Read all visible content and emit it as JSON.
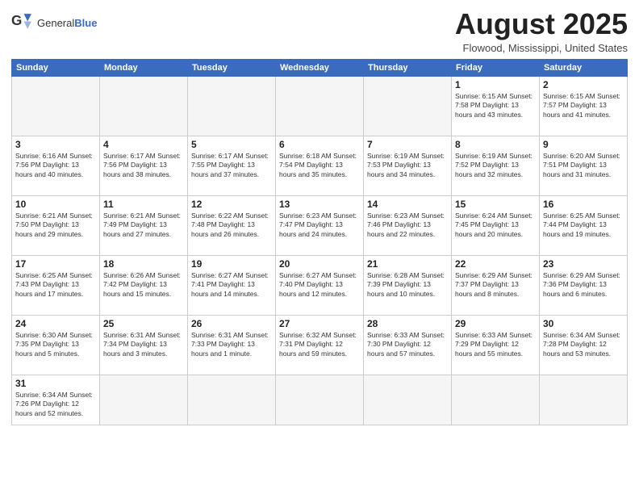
{
  "header": {
    "logo_text_normal": "General",
    "logo_text_bold": "Blue",
    "main_title": "August 2025",
    "subtitle": "Flowood, Mississippi, United States"
  },
  "calendar": {
    "days_of_week": [
      "Sunday",
      "Monday",
      "Tuesday",
      "Wednesday",
      "Thursday",
      "Friday",
      "Saturday"
    ],
    "weeks": [
      [
        {
          "day": "",
          "empty": true
        },
        {
          "day": "",
          "empty": true
        },
        {
          "day": "",
          "empty": true
        },
        {
          "day": "",
          "empty": true
        },
        {
          "day": "",
          "empty": true
        },
        {
          "day": "1",
          "info": "Sunrise: 6:15 AM\nSunset: 7:58 PM\nDaylight: 13 hours\nand 43 minutes."
        },
        {
          "day": "2",
          "info": "Sunrise: 6:15 AM\nSunset: 7:57 PM\nDaylight: 13 hours\nand 41 minutes."
        }
      ],
      [
        {
          "day": "3",
          "info": "Sunrise: 6:16 AM\nSunset: 7:56 PM\nDaylight: 13 hours\nand 40 minutes."
        },
        {
          "day": "4",
          "info": "Sunrise: 6:17 AM\nSunset: 7:56 PM\nDaylight: 13 hours\nand 38 minutes."
        },
        {
          "day": "5",
          "info": "Sunrise: 6:17 AM\nSunset: 7:55 PM\nDaylight: 13 hours\nand 37 minutes."
        },
        {
          "day": "6",
          "info": "Sunrise: 6:18 AM\nSunset: 7:54 PM\nDaylight: 13 hours\nand 35 minutes."
        },
        {
          "day": "7",
          "info": "Sunrise: 6:19 AM\nSunset: 7:53 PM\nDaylight: 13 hours\nand 34 minutes."
        },
        {
          "day": "8",
          "info": "Sunrise: 6:19 AM\nSunset: 7:52 PM\nDaylight: 13 hours\nand 32 minutes."
        },
        {
          "day": "9",
          "info": "Sunrise: 6:20 AM\nSunset: 7:51 PM\nDaylight: 13 hours\nand 31 minutes."
        }
      ],
      [
        {
          "day": "10",
          "info": "Sunrise: 6:21 AM\nSunset: 7:50 PM\nDaylight: 13 hours\nand 29 minutes."
        },
        {
          "day": "11",
          "info": "Sunrise: 6:21 AM\nSunset: 7:49 PM\nDaylight: 13 hours\nand 27 minutes."
        },
        {
          "day": "12",
          "info": "Sunrise: 6:22 AM\nSunset: 7:48 PM\nDaylight: 13 hours\nand 26 minutes."
        },
        {
          "day": "13",
          "info": "Sunrise: 6:23 AM\nSunset: 7:47 PM\nDaylight: 13 hours\nand 24 minutes."
        },
        {
          "day": "14",
          "info": "Sunrise: 6:23 AM\nSunset: 7:46 PM\nDaylight: 13 hours\nand 22 minutes."
        },
        {
          "day": "15",
          "info": "Sunrise: 6:24 AM\nSunset: 7:45 PM\nDaylight: 13 hours\nand 20 minutes."
        },
        {
          "day": "16",
          "info": "Sunrise: 6:25 AM\nSunset: 7:44 PM\nDaylight: 13 hours\nand 19 minutes."
        }
      ],
      [
        {
          "day": "17",
          "info": "Sunrise: 6:25 AM\nSunset: 7:43 PM\nDaylight: 13 hours\nand 17 minutes."
        },
        {
          "day": "18",
          "info": "Sunrise: 6:26 AM\nSunset: 7:42 PM\nDaylight: 13 hours\nand 15 minutes."
        },
        {
          "day": "19",
          "info": "Sunrise: 6:27 AM\nSunset: 7:41 PM\nDaylight: 13 hours\nand 14 minutes."
        },
        {
          "day": "20",
          "info": "Sunrise: 6:27 AM\nSunset: 7:40 PM\nDaylight: 13 hours\nand 12 minutes."
        },
        {
          "day": "21",
          "info": "Sunrise: 6:28 AM\nSunset: 7:39 PM\nDaylight: 13 hours\nand 10 minutes."
        },
        {
          "day": "22",
          "info": "Sunrise: 6:29 AM\nSunset: 7:37 PM\nDaylight: 13 hours\nand 8 minutes."
        },
        {
          "day": "23",
          "info": "Sunrise: 6:29 AM\nSunset: 7:36 PM\nDaylight: 13 hours\nand 6 minutes."
        }
      ],
      [
        {
          "day": "24",
          "info": "Sunrise: 6:30 AM\nSunset: 7:35 PM\nDaylight: 13 hours\nand 5 minutes."
        },
        {
          "day": "25",
          "info": "Sunrise: 6:31 AM\nSunset: 7:34 PM\nDaylight: 13 hours\nand 3 minutes."
        },
        {
          "day": "26",
          "info": "Sunrise: 6:31 AM\nSunset: 7:33 PM\nDaylight: 13 hours\nand 1 minute."
        },
        {
          "day": "27",
          "info": "Sunrise: 6:32 AM\nSunset: 7:31 PM\nDaylight: 12 hours\nand 59 minutes."
        },
        {
          "day": "28",
          "info": "Sunrise: 6:33 AM\nSunset: 7:30 PM\nDaylight: 12 hours\nand 57 minutes."
        },
        {
          "day": "29",
          "info": "Sunrise: 6:33 AM\nSunset: 7:29 PM\nDaylight: 12 hours\nand 55 minutes."
        },
        {
          "day": "30",
          "info": "Sunrise: 6:34 AM\nSunset: 7:28 PM\nDaylight: 12 hours\nand 53 minutes."
        }
      ],
      [
        {
          "day": "31",
          "info": "Sunrise: 6:34 AM\nSunset: 7:26 PM\nDaylight: 12 hours\nand 52 minutes.",
          "last": true
        },
        {
          "day": "",
          "empty": true,
          "last": true
        },
        {
          "day": "",
          "empty": true,
          "last": true
        },
        {
          "day": "",
          "empty": true,
          "last": true
        },
        {
          "day": "",
          "empty": true,
          "last": true
        },
        {
          "day": "",
          "empty": true,
          "last": true
        },
        {
          "day": "",
          "empty": true,
          "last": true
        }
      ]
    ]
  }
}
